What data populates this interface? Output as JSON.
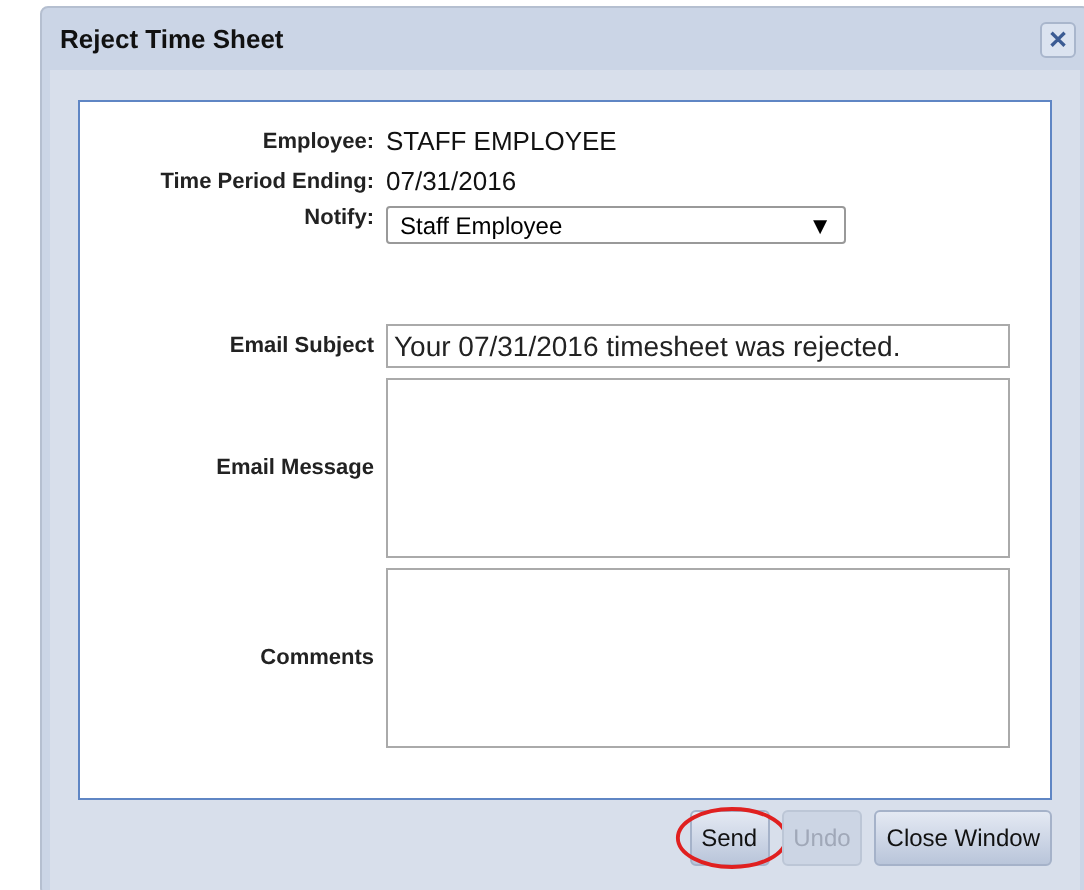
{
  "window": {
    "title": "Reject Time Sheet",
    "close": "✕"
  },
  "info": [
    {
      "label": "Employee:",
      "value": "STAFF EMPLOYEE"
    },
    {
      "label": "Time Period Ending:",
      "value": "07/31/2016"
    }
  ],
  "notify": {
    "label": "Notify:",
    "value": "Staff Employee",
    "arrow": "▼"
  },
  "fields": [
    {
      "kind": "line",
      "label": "Email Subject",
      "value": "Your 07/31/2016 timesheet was rejected."
    },
    {
      "kind": "area",
      "label": "Email Message"
    },
    {
      "kind": "area",
      "label": "Comments"
    }
  ],
  "buttons": [
    {
      "label": "Send",
      "disabled": false,
      "circled": true
    },
    {
      "label": "Undo",
      "disabled": true,
      "circled": false
    },
    {
      "label": "Close Window",
      "disabled": false,
      "circled": false
    }
  ]
}
